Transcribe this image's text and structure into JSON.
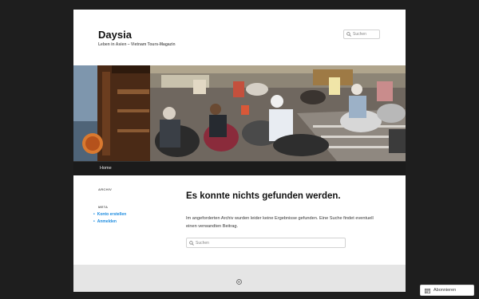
{
  "site": {
    "title": "Daysia",
    "description": "Leben in Asien – Vietnam Tours-Magazin"
  },
  "header_search": {
    "placeholder": "Suchen"
  },
  "nav": {
    "items": [
      {
        "label": "Home"
      }
    ]
  },
  "sidebar": {
    "archive_title": "ARCHIV",
    "meta_title": "META",
    "meta_items": [
      {
        "label": "Konto erstellen"
      },
      {
        "label": "Anmelden"
      }
    ]
  },
  "main": {
    "title": "Es konnte nichts gefunden werden.",
    "text": "Im angeforderten Archiv wurden leider keine Ergebnisse gefunden. Eine Suche findet eventuell einen verwandten Beitrag.",
    "search_placeholder": "Suchen"
  },
  "follow": {
    "label": "Abonnieren"
  },
  "footer": {
    "icon": "wordpress-icon"
  }
}
